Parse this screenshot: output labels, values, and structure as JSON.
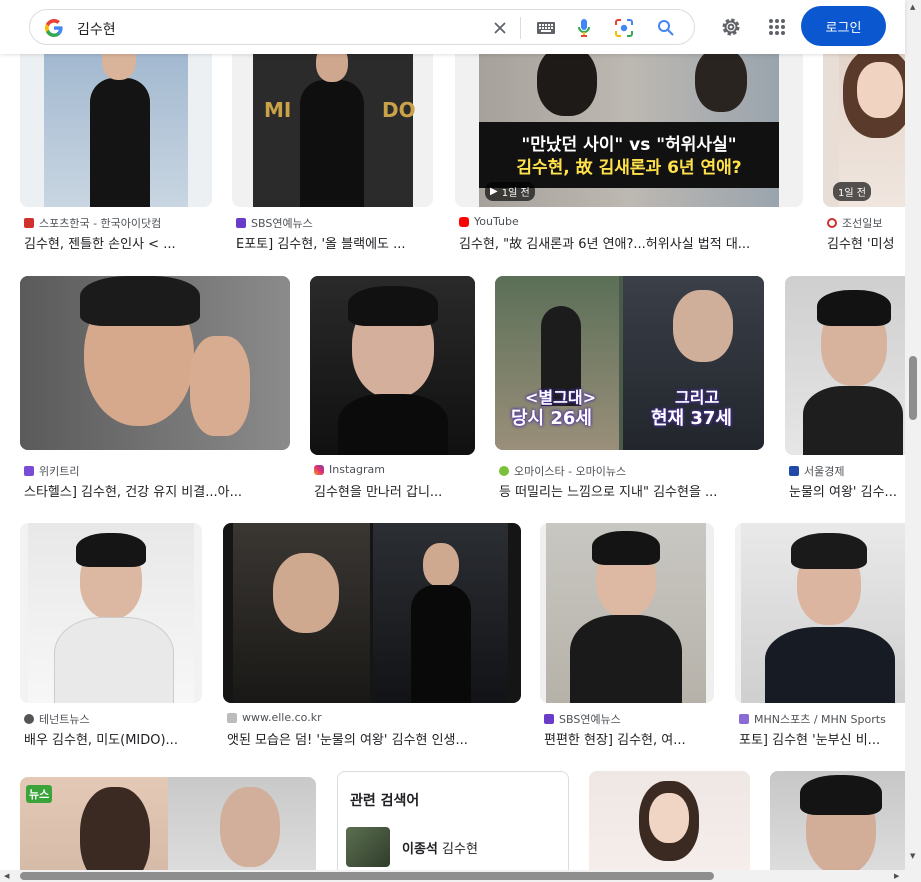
{
  "search": {
    "query": "김수현",
    "login_label": "로그인"
  },
  "colors": {
    "accent": "#0b57d0",
    "google_blue": "#4285f4",
    "google_red": "#ea4335",
    "google_yellow": "#fbbc05",
    "google_green": "#34a853"
  },
  "icons": [
    "google-logo-icon",
    "clear-icon",
    "keyboard-icon",
    "mic-icon",
    "lens-icon",
    "search-icon",
    "settings-icon",
    "apps-icon"
  ],
  "results": [
    {
      "source": "스포츠한국 - 한국아이닷컴",
      "title": "김수현, 젠틀한 손인사 < ..."
    },
    {
      "source": "SBS연예뉴스",
      "title": "E포토] 김수현, '올 블랙에도 ..."
    },
    {
      "source": "YouTube",
      "title": "김수현, \"故 김새론과 6년 연애?...허위사실 법적 대...",
      "badge": "1일 전",
      "overlay_line1": "\"만났던 사이\" vs  \"허위사실\"",
      "overlay_line2": "김수현, 故 김새론과 6년 연애?"
    },
    {
      "source": "조선일보",
      "title": "김수현 '미성",
      "badge": "1일 전"
    },
    {
      "source": "위키트리",
      "title": "스타헬스] 김수현, 건강 유지 비결...아..."
    },
    {
      "source": "Instagram",
      "title": "김수현을 만나러 갑니..."
    },
    {
      "source": "오마이스타 - 오마이뉴스",
      "title": "등 떠밀리는 느낌으로 지내\" 김수현을 ...",
      "overlay_left_1": "<별그대>",
      "overlay_left_2": "당시 26세",
      "overlay_right_1": "그리고",
      "overlay_right_2": "현재 37세"
    },
    {
      "source": "서울경제",
      "title": "눈물의 여왕' 김수..."
    },
    {
      "source": "테넌트뉴스",
      "title": "배우 김수현, 미도(MIDO)..."
    },
    {
      "source": "www.elle.co.kr",
      "title": "앳된 모습은 덤! '눈물의 여왕' 김수현 인생..."
    },
    {
      "source": "SBS연예뉴스",
      "title": "편편한 현장] 김수현, 여..."
    },
    {
      "source": "MHN스포츠 / MHN Sports",
      "title": "포토] 김수현 '눈부신 비..."
    }
  ],
  "related": {
    "title": "관련 검색어",
    "item_bold": "이종석",
    "item_rest": " 김수현"
  }
}
